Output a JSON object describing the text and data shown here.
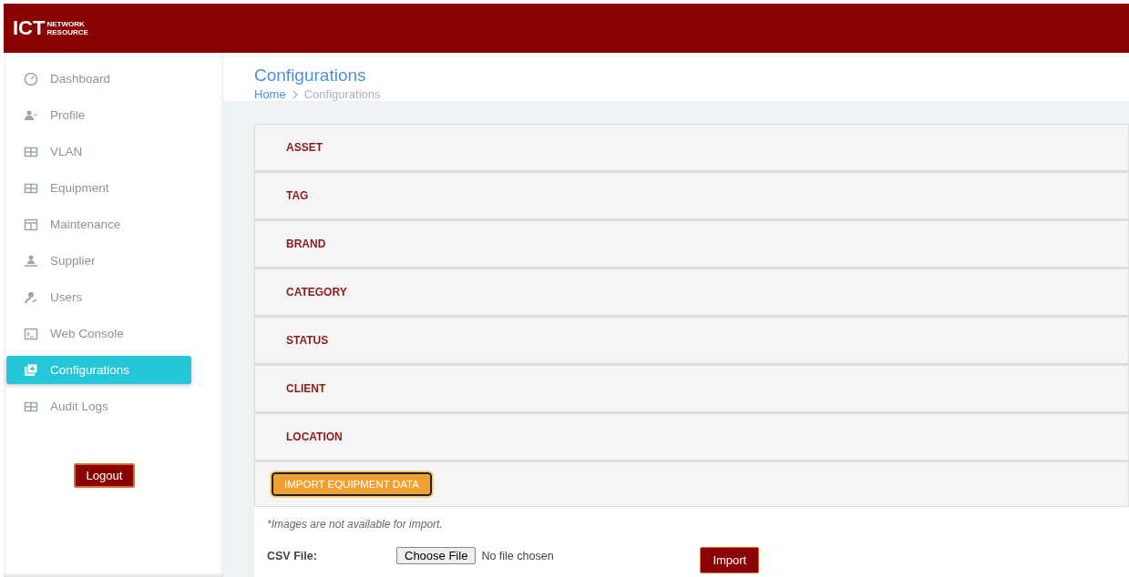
{
  "header": {
    "logo_main": "ICT",
    "logo_sub": [
      "NETWORK",
      "RESOURCE"
    ]
  },
  "sidebar": {
    "items": [
      {
        "label": "Dashboard",
        "selected": false
      },
      {
        "label": "Profile",
        "selected": false
      },
      {
        "label": "VLAN",
        "selected": false
      },
      {
        "label": "Equipment",
        "selected": false
      },
      {
        "label": "Maintenance",
        "selected": false
      },
      {
        "label": "Supplier",
        "selected": false
      },
      {
        "label": "Users",
        "selected": false
      },
      {
        "label": "Web Console",
        "selected": false
      },
      {
        "label": "Configurations",
        "selected": true
      },
      {
        "label": "Audit Logs",
        "selected": false
      }
    ],
    "logout": "Logout"
  },
  "page": {
    "title": "Configurations",
    "breadcrumb": [
      "Home",
      "Configurations"
    ]
  },
  "panels": [
    "ASSET",
    "TAG",
    "BRAND",
    "CATEGORY",
    "STATUS",
    "CLIENT",
    "LOCATION"
  ],
  "import": {
    "button": "IMPORT EQUIPMENT DATA",
    "note": "*Images are not available for import.",
    "file_label": "CSV File:",
    "choose": "Choose File",
    "file_status": "No file chosen",
    "submit": "Import"
  }
}
